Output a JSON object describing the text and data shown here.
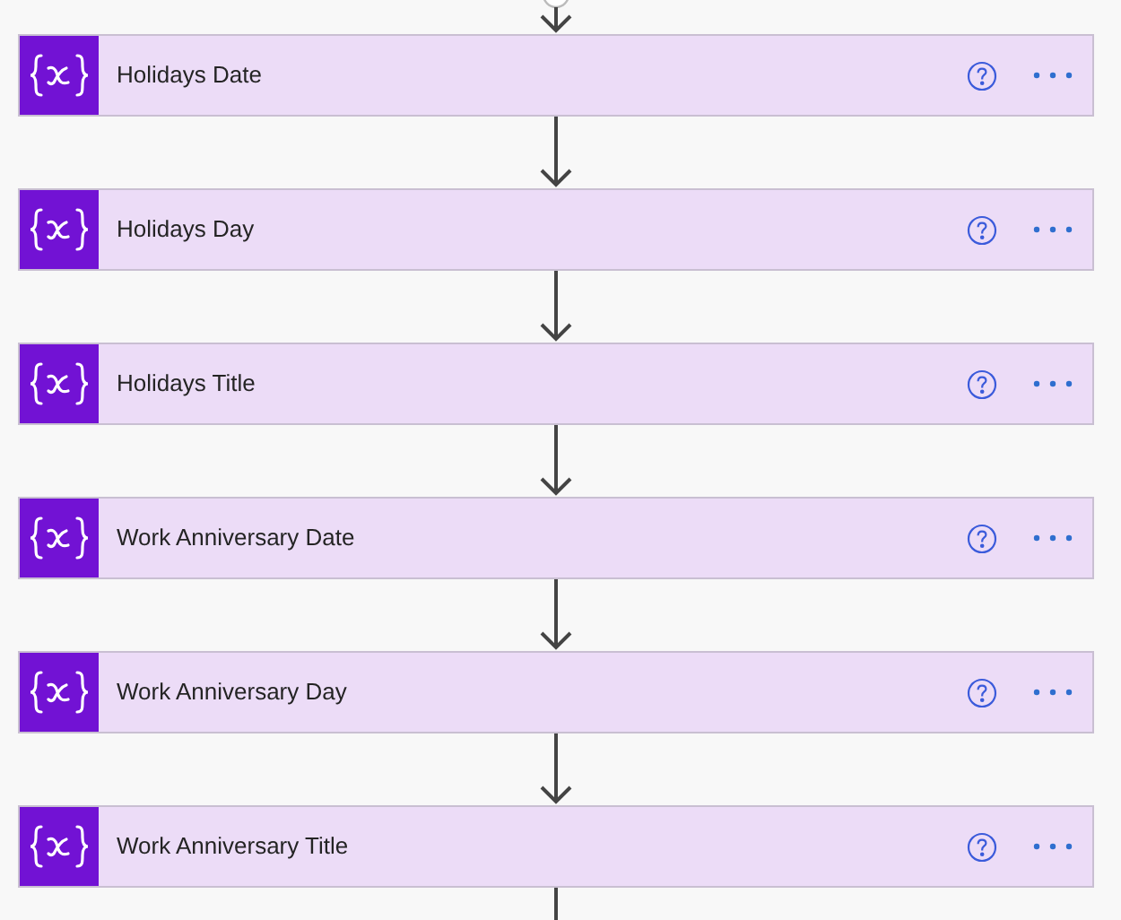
{
  "actions": [
    {
      "title": "Holidays Date"
    },
    {
      "title": "Holidays Day"
    },
    {
      "title": "Holidays Title"
    },
    {
      "title": "Work Anniversary Date"
    },
    {
      "title": "Work Anniversary Day"
    },
    {
      "title": "Work Anniversary Title"
    }
  ]
}
